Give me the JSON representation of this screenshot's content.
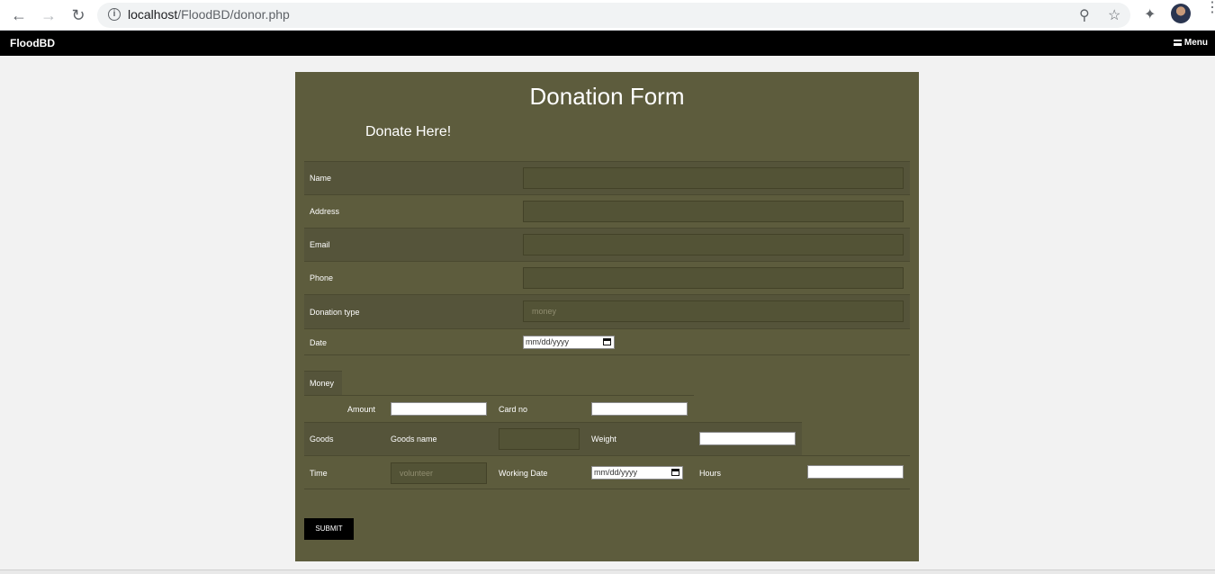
{
  "browser": {
    "url_host": "localhost",
    "url_path": "/FloodBD/donor.php",
    "icons": [
      "back-icon",
      "forward-icon",
      "reload-icon",
      "info-icon",
      "zoom-out-icon",
      "star-icon",
      "extensions-icon",
      "avatar",
      "more-icon"
    ]
  },
  "navbar": {
    "brand": "FloodBD",
    "menu_label": "Menu"
  },
  "form": {
    "title": "Donation Form",
    "subtitle": "Donate Here!",
    "fields": {
      "name": "Name",
      "address": "Address",
      "email": "Email",
      "phone": "Phone",
      "donation_type": "Donation type",
      "donation_type_value": "money",
      "date": "Date",
      "date_placeholder": "mm/dd/yyyy"
    },
    "money": {
      "tab": "Money",
      "amount": "Amount",
      "card_no": "Card no"
    },
    "goods": {
      "label": "Goods",
      "goods_name": "Goods name",
      "weight": "Weight"
    },
    "time": {
      "label": "Time",
      "volunteer_value": "volunteer",
      "working_date": "Working Date",
      "working_date_placeholder": "mm/dd/yyyy",
      "hours": "Hours"
    },
    "submit_label": "SUBMIT"
  },
  "colors": {
    "panel_bg": "#5d5c3d",
    "navbar_bg": "#000000",
    "page_bg": "#f2f2f2"
  }
}
